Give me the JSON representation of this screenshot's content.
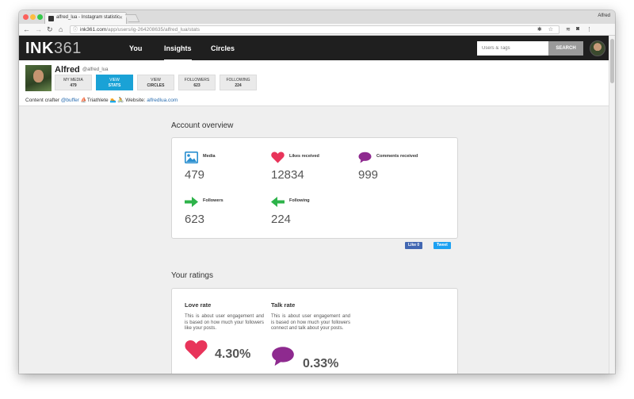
{
  "browser": {
    "tab_title": "alfred_lua - Instagram statistic",
    "profile_name": "Alfred",
    "url_host": "ink361.com",
    "url_path": "/app/users/ig-264208635/alfred_lua/stats"
  },
  "header": {
    "logo_bold": "INK",
    "logo_light": "361",
    "nav": [
      "You",
      "Insights",
      "Circles"
    ],
    "active_nav": "Insights",
    "search_placeholder": "Users & Tags",
    "search_button": "SEARCH"
  },
  "profile": {
    "name": "Alfred",
    "handle": "@alfred_lua",
    "buttons": [
      {
        "top": "MY MEDIA",
        "bottom": "479"
      },
      {
        "top": "VIEW",
        "bottom": "STATS"
      },
      {
        "top": "VIEW",
        "bottom": "CIRCLES"
      },
      {
        "top": "FOLLOWERS",
        "bottom": "623"
      },
      {
        "top": "FOLLOWING",
        "bottom": "224"
      }
    ],
    "bio_prefix": "Content crafter ",
    "bio_mention": "@buffer",
    "bio_mid": " ⛵Triathlete 🏊 🚴 Website: ",
    "bio_link": "alfredlua.com"
  },
  "overview": {
    "title": "Account overview",
    "metrics": [
      {
        "label": "Media",
        "value": "479",
        "icon": "image-icon"
      },
      {
        "label": "Likes received",
        "value": "12834",
        "icon": "heart-icon"
      },
      {
        "label": "Comments received",
        "value": "999",
        "icon": "speech-bubble-icon"
      },
      {
        "label": "Followers",
        "value": "623",
        "icon": "arrow-right-icon"
      },
      {
        "label": "Following",
        "value": "224",
        "icon": "arrow-left-icon"
      }
    ],
    "like_label": "Like 0",
    "tweet_label": "Tweet"
  },
  "ratings": {
    "title": "Your ratings",
    "love": {
      "title": "Love rate",
      "desc": "This is about user engagement and is based on how much your followers like your posts.",
      "value": "4.30%"
    },
    "talk": {
      "title": "Talk rate",
      "desc": "This is about user engagement and is based on how much your followers connect and talk about your posts.",
      "value": "0.33%"
    }
  },
  "colors": {
    "accent": "#1aa2d6",
    "heart": "#e8345a",
    "bubble": "#8e2a8f",
    "arrow": "#2db34a",
    "image": "#2a8fd0"
  }
}
